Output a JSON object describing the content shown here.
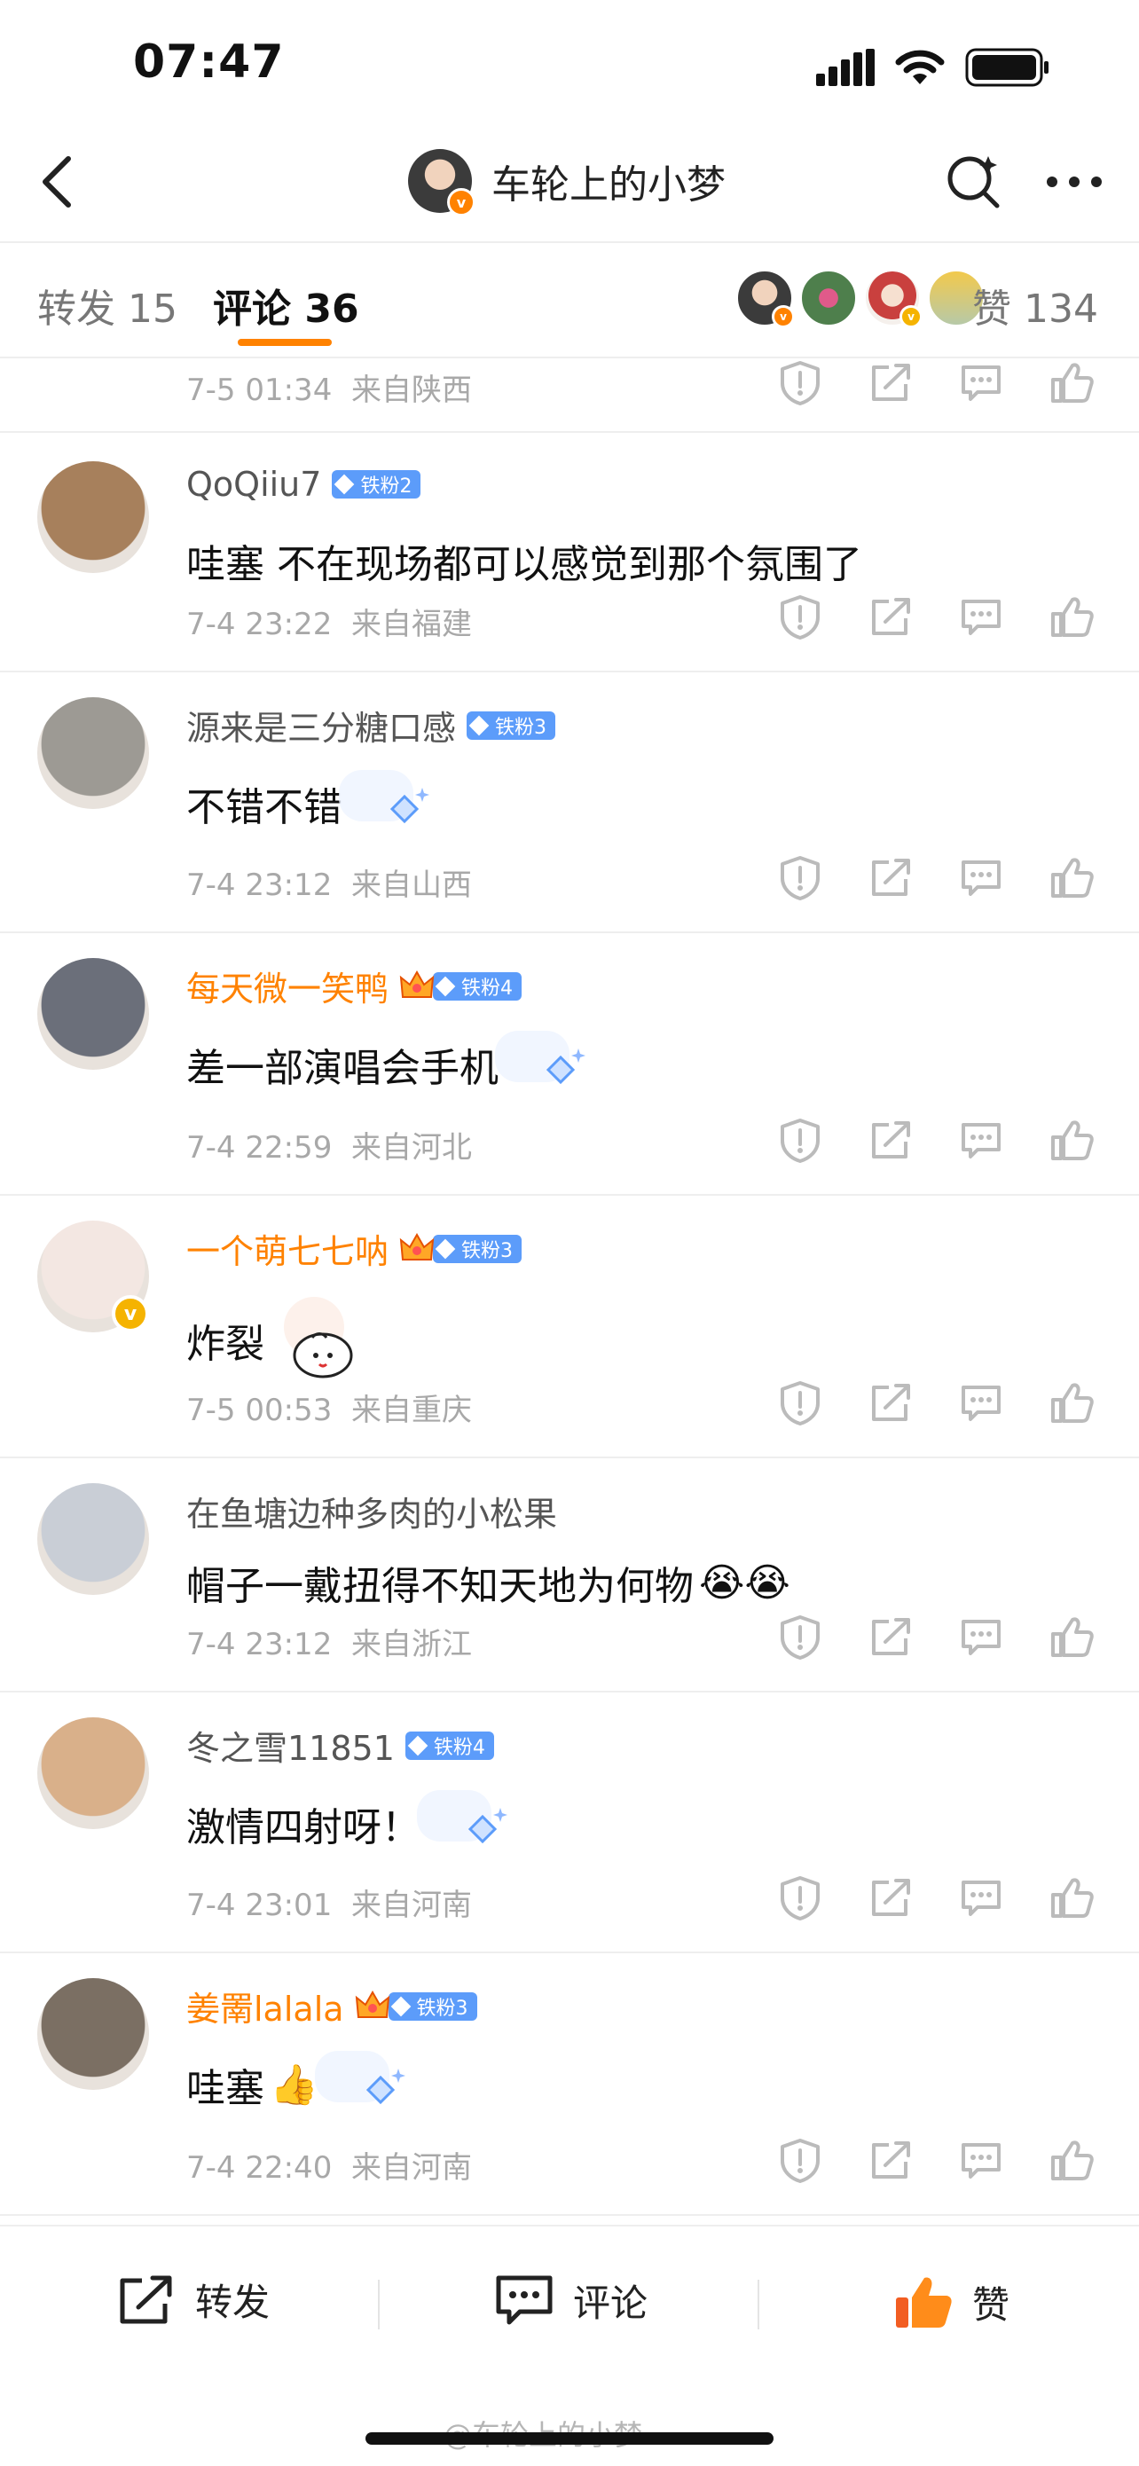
{
  "status_bar": {
    "time": "07:47"
  },
  "nav": {
    "title": "车轮上的小梦"
  },
  "tabs": {
    "repost_label": "转发",
    "repost_count": "15",
    "comments_label": "评论",
    "comments_count": "36",
    "likes_label": "赞",
    "likes_count": "134"
  },
  "top_meta": {
    "time": "7-5 01:34",
    "location": "来自陕西"
  },
  "comments": [
    {
      "name": "QoQiiu7",
      "name_color": "#555555",
      "badge": "铁粉2",
      "crown": false,
      "text": "哇塞 不在现场都可以感觉到那个氛围了",
      "sticker": "",
      "emoji": "",
      "time": "7-4 23:22",
      "location": "来自福建",
      "avatar_color": "#a7805c",
      "verified": false
    },
    {
      "name": "源来是三分糖口感",
      "name_color": "#555555",
      "badge": "铁粉3",
      "crown": false,
      "text": "不错不错",
      "sticker": "diamond",
      "emoji": "",
      "time": "7-4 23:12",
      "location": "来自山西",
      "avatar_color": "#9d9a94",
      "verified": false
    },
    {
      "name": "每天微一笑鸭",
      "name_color": "#ff8200",
      "badge": "铁粉4",
      "crown": true,
      "text": "差一部演唱会手机",
      "sticker": "diamond",
      "emoji": "",
      "time": "7-4 22:59",
      "location": "来自河北",
      "avatar_color": "#6b6f7a",
      "verified": false
    },
    {
      "name": "一个萌七七呐",
      "name_color": "#ff8200",
      "badge": "铁粉3",
      "crown": true,
      "text": "炸裂",
      "sticker": "bun",
      "emoji": "",
      "time": "7-5 00:53",
      "location": "来自重庆",
      "avatar_color": "#f3e7e2",
      "verified": true
    },
    {
      "name": "在鱼塘边种多肉的小松果",
      "name_color": "#555555",
      "badge": "",
      "crown": false,
      "text": "帽子一戴扭得不知天地为何物",
      "sticker": "",
      "emoji": "😭😭",
      "time": "7-4 23:12",
      "location": "来自浙江",
      "avatar_color": "#c9ced6",
      "verified": false
    },
    {
      "name": "冬之雪11851",
      "name_color": "#555555",
      "badge": "铁粉4",
      "crown": false,
      "text": "激情四射呀！",
      "sticker": "diamond",
      "emoji": "",
      "time": "7-4 23:01",
      "location": "来自河南",
      "avatar_color": "#d9b08a",
      "verified": false
    },
    {
      "name": "姜罱lalala",
      "name_color": "#ff8200",
      "badge": "铁粉3",
      "crown": true,
      "text": "哇塞",
      "sticker": "diamond",
      "emoji": "👍",
      "time": "7-4 22:40",
      "location": "来自河南",
      "avatar_color": "#7b6f63",
      "verified": false
    }
  ],
  "bottom_bar": {
    "repost": "转发",
    "comment": "评论",
    "like": "赞"
  },
  "watermark": "@车轮上的小梦",
  "colors": {
    "accent": "#ff8200",
    "badge": "#5c9cfa",
    "meta": "#a8a8a8"
  }
}
